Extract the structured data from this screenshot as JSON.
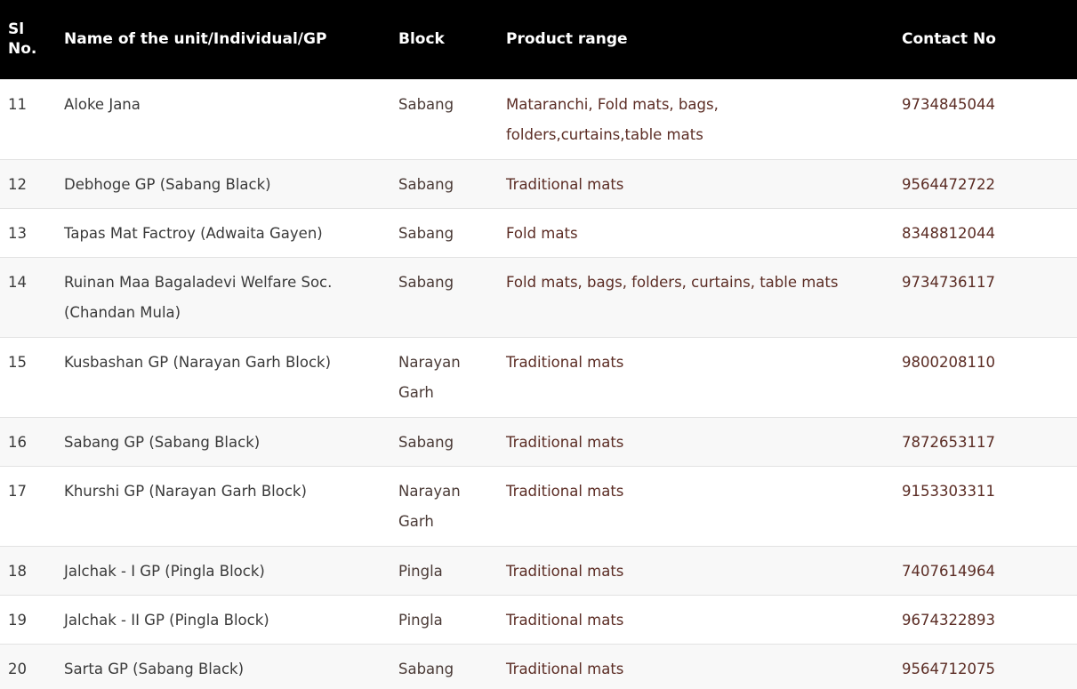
{
  "table": {
    "headers": {
      "sl": "Sl No.",
      "name": "Name of the unit/Individual/GP",
      "block": "Block",
      "product": "Product range",
      "contact": "Contact No"
    },
    "rows": [
      {
        "sl": "11",
        "name": "Aloke Jana",
        "block": "Sabang",
        "product": "Mataranchi, Fold mats, bags, folders,curtains,table mats",
        "contact": "9734845044"
      },
      {
        "sl": "12",
        "name": "Debhoge GP (Sabang Black)",
        "block": "Sabang",
        "product": "Traditional mats",
        "contact": "9564472722"
      },
      {
        "sl": "13",
        "name": "Tapas Mat Factroy (Adwaita Gayen)",
        "block": "Sabang",
        "product": "Fold mats",
        "contact": "8348812044"
      },
      {
        "sl": "14",
        "name": "Ruinan Maa Bagaladevi Welfare Soc. (Chandan Mula)",
        "block": "Sabang",
        "product": "Fold mats, bags, folders, curtains, table mats",
        "contact": "9734736117"
      },
      {
        "sl": "15",
        "name": "Kusbashan GP (Narayan Garh Block)",
        "block": "Narayan Garh",
        "product": "Traditional mats",
        "contact": "9800208110"
      },
      {
        "sl": "16",
        "name": "Sabang GP (Sabang Black)",
        "block": "Sabang",
        "product": "Traditional mats",
        "contact": "7872653117"
      },
      {
        "sl": "17",
        "name": "Khurshi GP (Narayan Garh Block)",
        "block": "Narayan Garh",
        "product": "Traditional mats",
        "contact": "9153303311"
      },
      {
        "sl": "18",
        "name": "Jalchak - I GP (Pingla Block)",
        "block": "Pingla",
        "product": "Traditional mats",
        "contact": "7407614964"
      },
      {
        "sl": "19",
        "name": "Jalchak - II GP (Pingla Block)",
        "block": "Pingla",
        "product": "Traditional mats",
        "contact": "9674322893"
      },
      {
        "sl": "20",
        "name": "Sarta GP (Sabang Black)",
        "block": "Sabang",
        "product": "Traditional mats",
        "contact": "9564712075"
      }
    ]
  }
}
